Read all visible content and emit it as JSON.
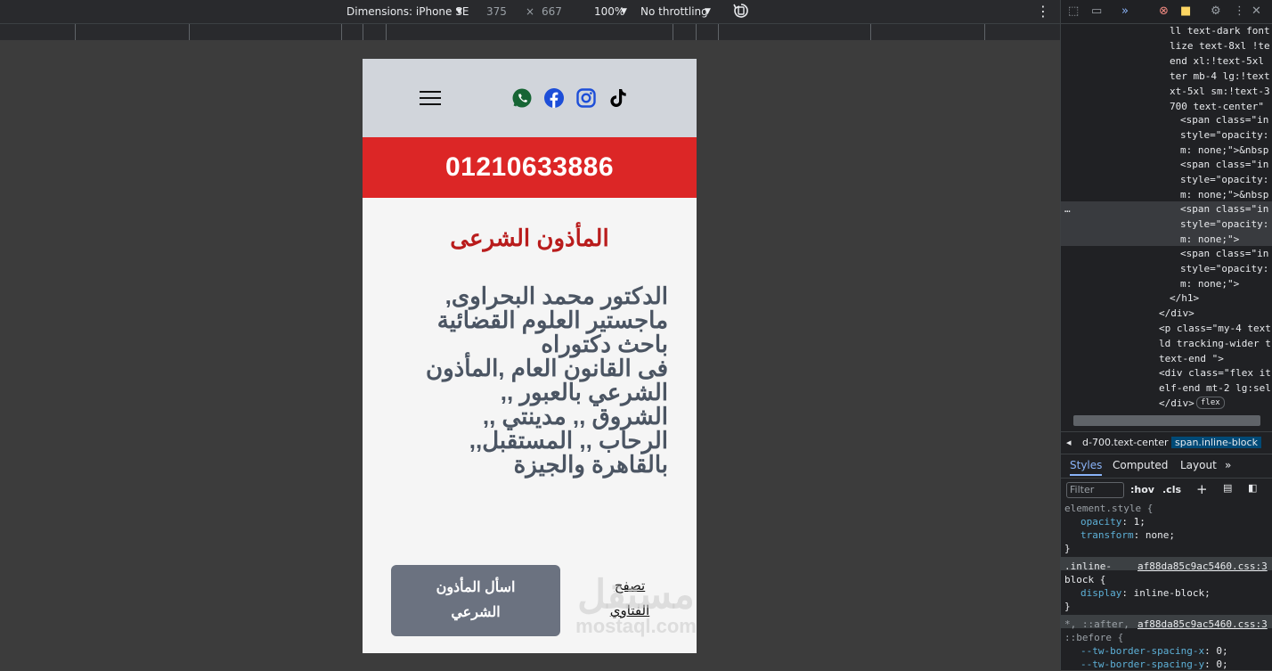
{
  "devtools": {
    "dimensions_label": "Dimensions: iPhone SE",
    "width": "375",
    "times": "×",
    "height": "667",
    "zoom": "100%",
    "throttling": "No throttling",
    "tabs": [
      "Styles",
      "Computed",
      "Layout"
    ],
    "breadcrumbs": [
      "d-700.text-center",
      "span.inline-block"
    ],
    "filter_placeholder": "Filter",
    "hov": ":hov",
    "cls": ".cls",
    "code_lines": [
      "ll text-dark font",
      "lize text-8xl !te",
      "end xl:!text-5xl",
      "ter mb-4 lg:!text",
      "xt-5xl sm:!text-3",
      "700  text-center\"",
      "<span class=\"in",
      "style=\"opacity:",
      "m: none;\">&nbsp",
      "<span class=\"in",
      "style=\"opacity:",
      "m: none;\">&nbsp",
      "<span class=\"in",
      "style=\"opacity:",
      "m: none;\">",
      "<span class=\"in",
      "style=\"opacity:",
      "m: none;\">",
      "</h1>",
      "</div>",
      "<p class=\"my-4 text",
      "ld tracking-wider t",
      "text-end \">",
      "<div class=\"flex it",
      "elf-end mt-2 lg:sel",
      "</div>"
    ],
    "flex_badge": "flex",
    "styles": {
      "element_style": "element.style {",
      "rule1_prop1": "opacity",
      "rule1_val1": "1;",
      "rule1_prop2": "transform",
      "rule1_val2": "none;",
      "close": "}",
      "rule2_selector": ".inline-",
      "rule2_selector2": "block {",
      "rule2_source": "af88da85c9ac5460.css:3",
      "rule2_prop": "display",
      "rule2_val": "inline-block;",
      "rule3_selector": "*, ::after,",
      "rule3_selector2": "::before {",
      "rule3_source": "af88da85c9ac5460.css:3",
      "rule3_prop1": "--tw-border-spacing-x",
      "rule3_val1": "0;",
      "rule3_prop2": "--tw-border-spacing-y",
      "rule3_val2": "0;"
    }
  },
  "site": {
    "phone_number": "01210633886",
    "title": "المأذون الشرعى",
    "bio_lines": [
      "الدكتور محمد البحراوى,",
      "ماجستير العلوم القضائية",
      "باحث دكتوراه",
      "فى القانون العام ,المأذون",
      "الشرعي بالعبور ,,",
      "الشروق ,, مدينتي ,,",
      "الرحاب ,, المستقبل,,",
      "بالقاهرة والجيزة"
    ],
    "ask_button_line1": "اسأل المأذون",
    "ask_button_line2": "الشرعي",
    "fatwa_link_line1": "تصفح",
    "fatwa_link_line2": "الفتاوي",
    "colors": {
      "nav_bg": "#d1d5db",
      "phone_bar_bg": "#dc2626",
      "title_color": "#b91c1c",
      "button_bg": "#6b7280",
      "whatsapp": "#166534",
      "facebook": "#1d4ed8",
      "instagram": "#1d4ed8",
      "tiktok": "#000000"
    }
  },
  "watermark": {
    "arabic": "مستقل",
    "latin": "mostaql.com"
  }
}
